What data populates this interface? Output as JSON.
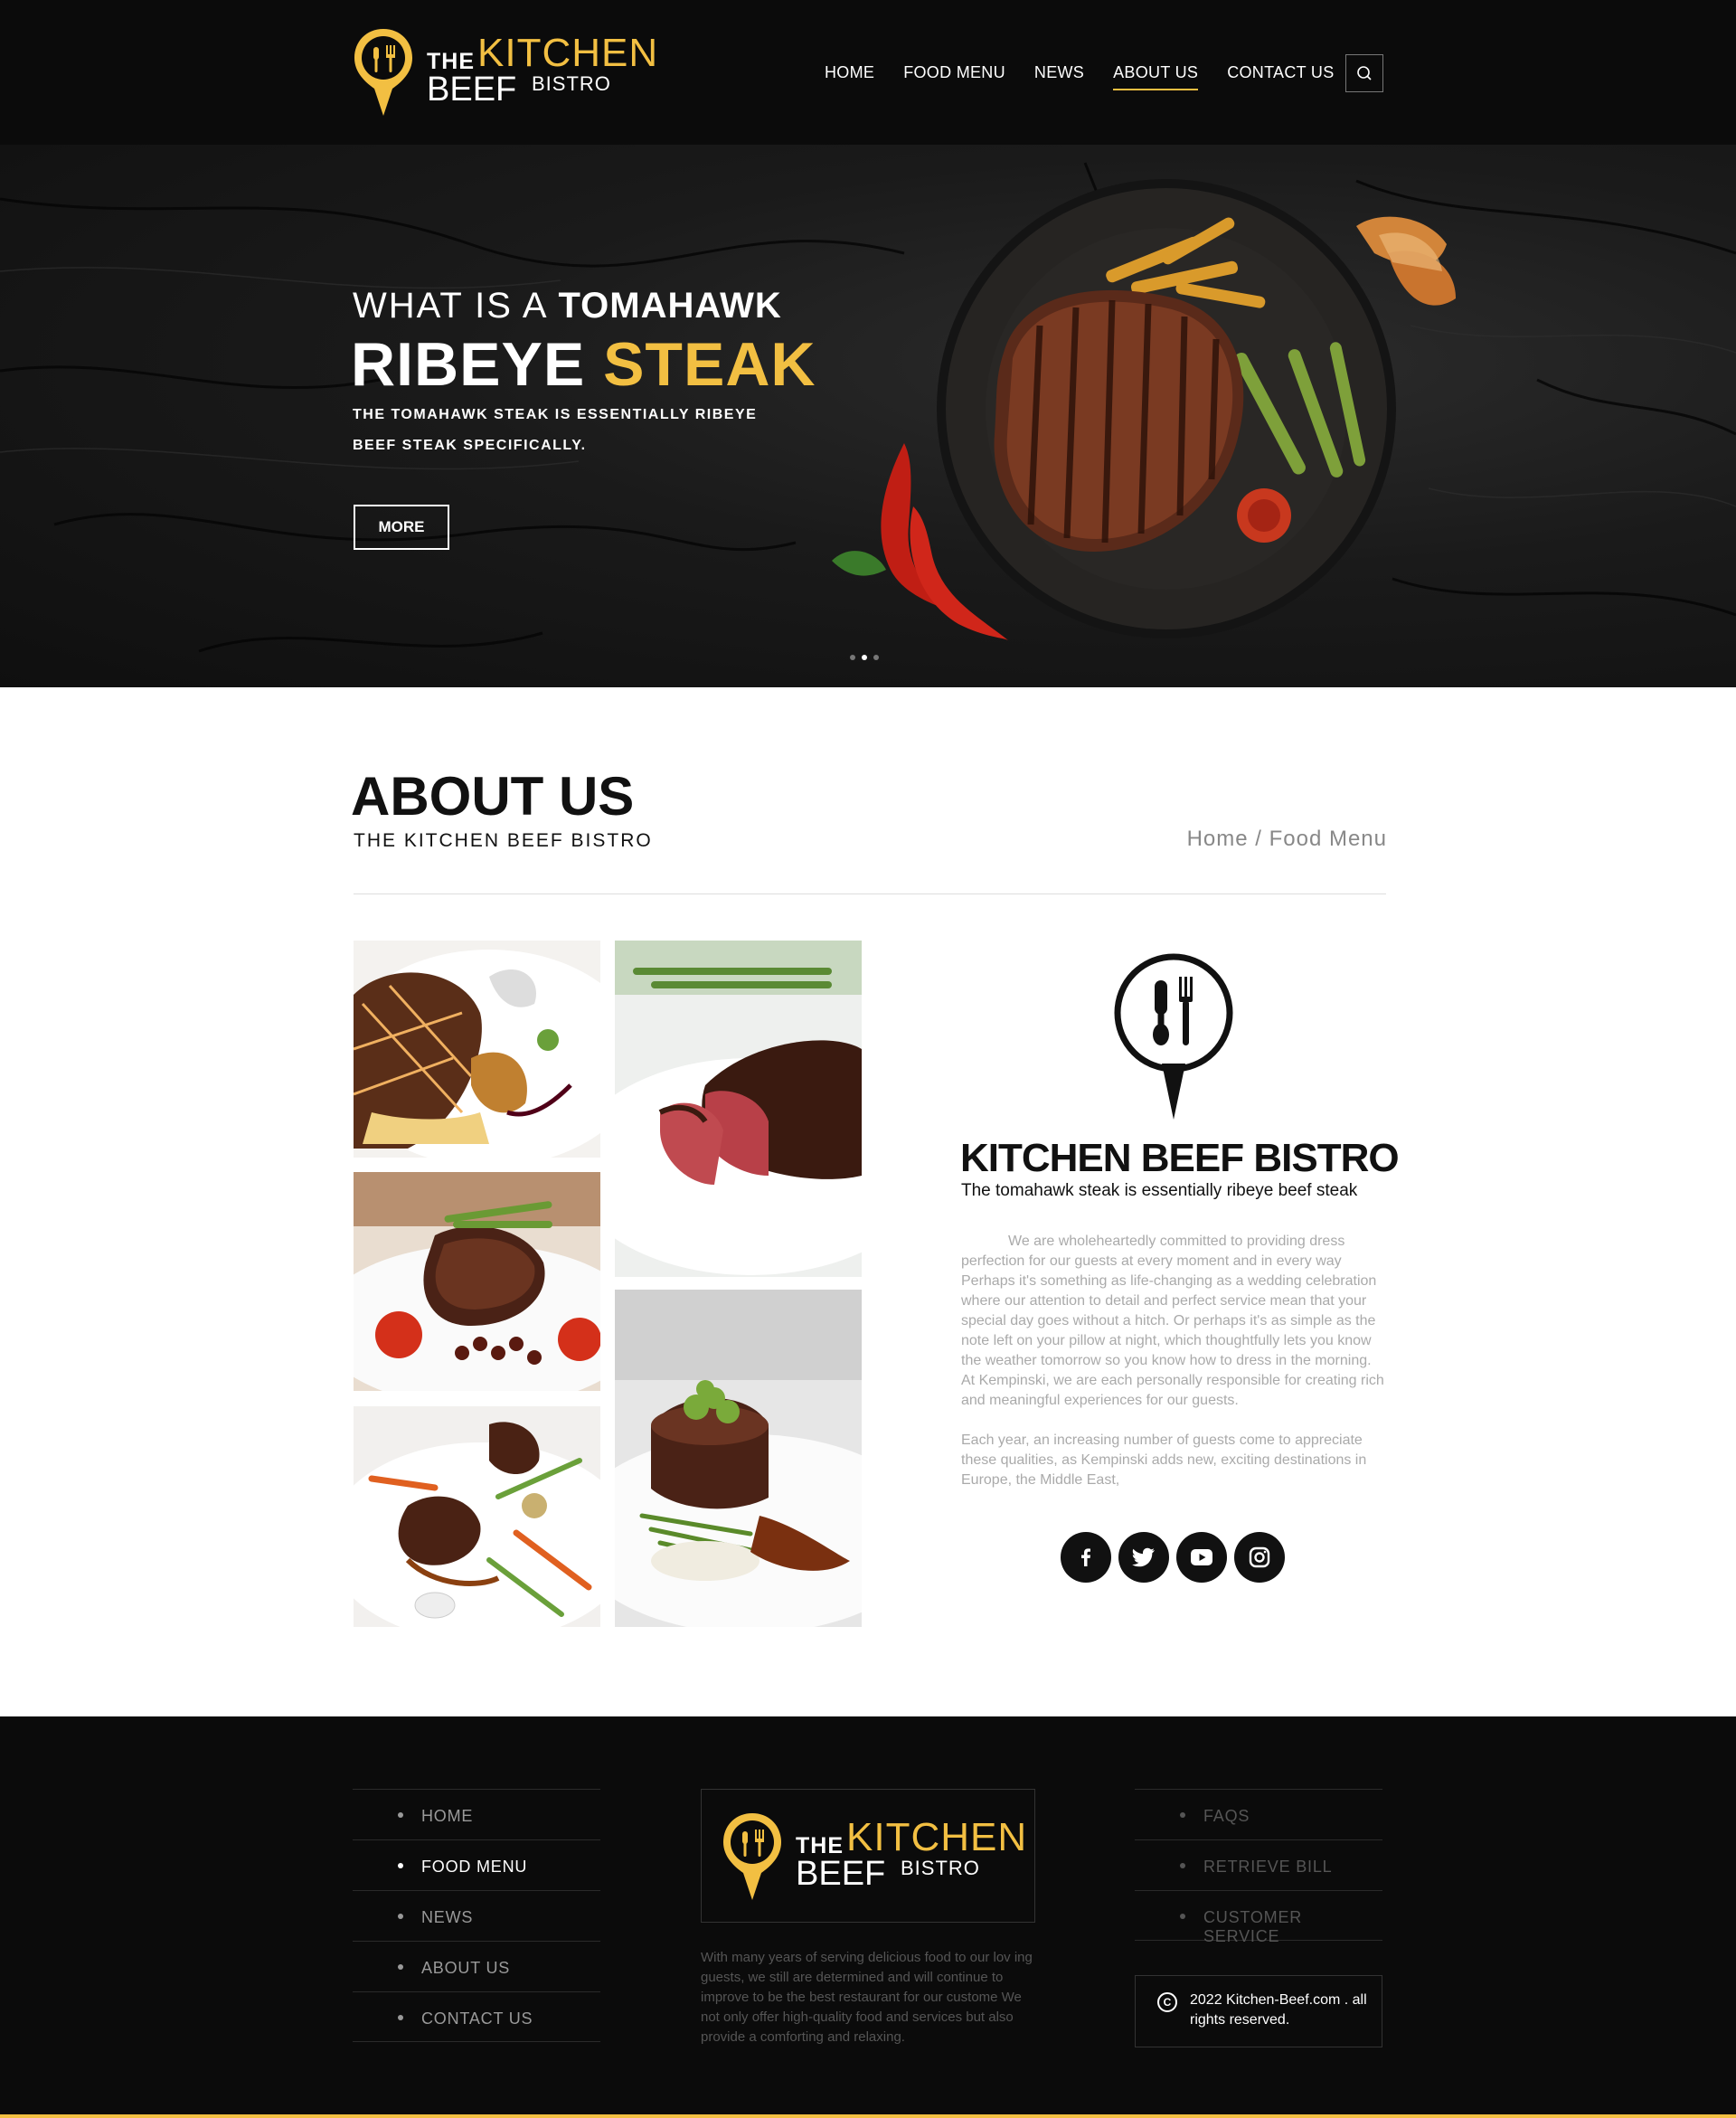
{
  "brand": {
    "the": "THE",
    "kitchen": "KITCHEN",
    "beef": "BEEF",
    "bistro": "BISTRO",
    "accent_color": "#f2bf42"
  },
  "nav": {
    "items": [
      {
        "label": "HOME",
        "active": false
      },
      {
        "label": "FOOD MENU",
        "active": false
      },
      {
        "label": "NEWS",
        "active": false
      },
      {
        "label": "ABOUT US",
        "active": true
      },
      {
        "label": "CONTACT US",
        "active": false
      }
    ],
    "search_icon": "search-icon"
  },
  "hero": {
    "line1_light": "WHAT IS A ",
    "line1_bold": "TOMAHAWK",
    "line2_white": "RIBEYE ",
    "line2_yellow": "STEAK",
    "subtitle": "THE TOMAHAWK STEAK IS ESSENTIALLY RIBEYE BEEF STEAK SPECIFICALLY.",
    "button_label": "MORE",
    "slides": 3,
    "active_slide": 2
  },
  "about": {
    "title": "ABOUT US",
    "subtitle": "THE KITCHEN BEEF BISTRO",
    "breadcrumb": "Home / Food Menu",
    "brand_title": "KITCHEN BEEF BISTRO",
    "brand_tagline": "The tomahawk steak is essentially ribeye beef steak",
    "paragraph1": "We are wholeheartedly committed to providing dress perfection for our guests at every moment and in every way Perhaps it's something as life-changing as a wedding celebration where our attention to detail and perfect service mean that your special day goes without a hitch. Or perhaps it's as simple as the note left on your pillow at night, which thoughtfully lets you know the weather tomorrow so you know how to dress in the morning. At Kempinski, we are each personally responsible for creating rich and meaningful experiences for our guests.",
    "paragraph2": "Each year, an increasing number of guests come to appreciate these qualities, as Kempinski adds new, exciting destinations in Europe, the Middle East,",
    "social": [
      "facebook-icon",
      "twitter-icon",
      "youtube-icon",
      "instagram-icon"
    ]
  },
  "footer": {
    "menu_left": [
      {
        "label": "HOME"
      },
      {
        "label": "FOOD MENU"
      },
      {
        "label": "NEWS"
      },
      {
        "label": "ABOUT US"
      },
      {
        "label": "CONTACT US"
      }
    ],
    "menu_right": [
      {
        "label": "FAQS"
      },
      {
        "label": "RETRIEVE BILL"
      },
      {
        "label": "CUSTOMER SERVICE"
      }
    ],
    "description": "With many years of serving delicious food to our lov ing guests, we still are determined and will continue to improve to be the best restaurant for our custome We not only offer high-quality food and services but also provide a comforting and relaxing.",
    "copyright": "2022 Kitchen-Beef.com . all rights reserved.",
    "copyright_symbol": "C"
  }
}
